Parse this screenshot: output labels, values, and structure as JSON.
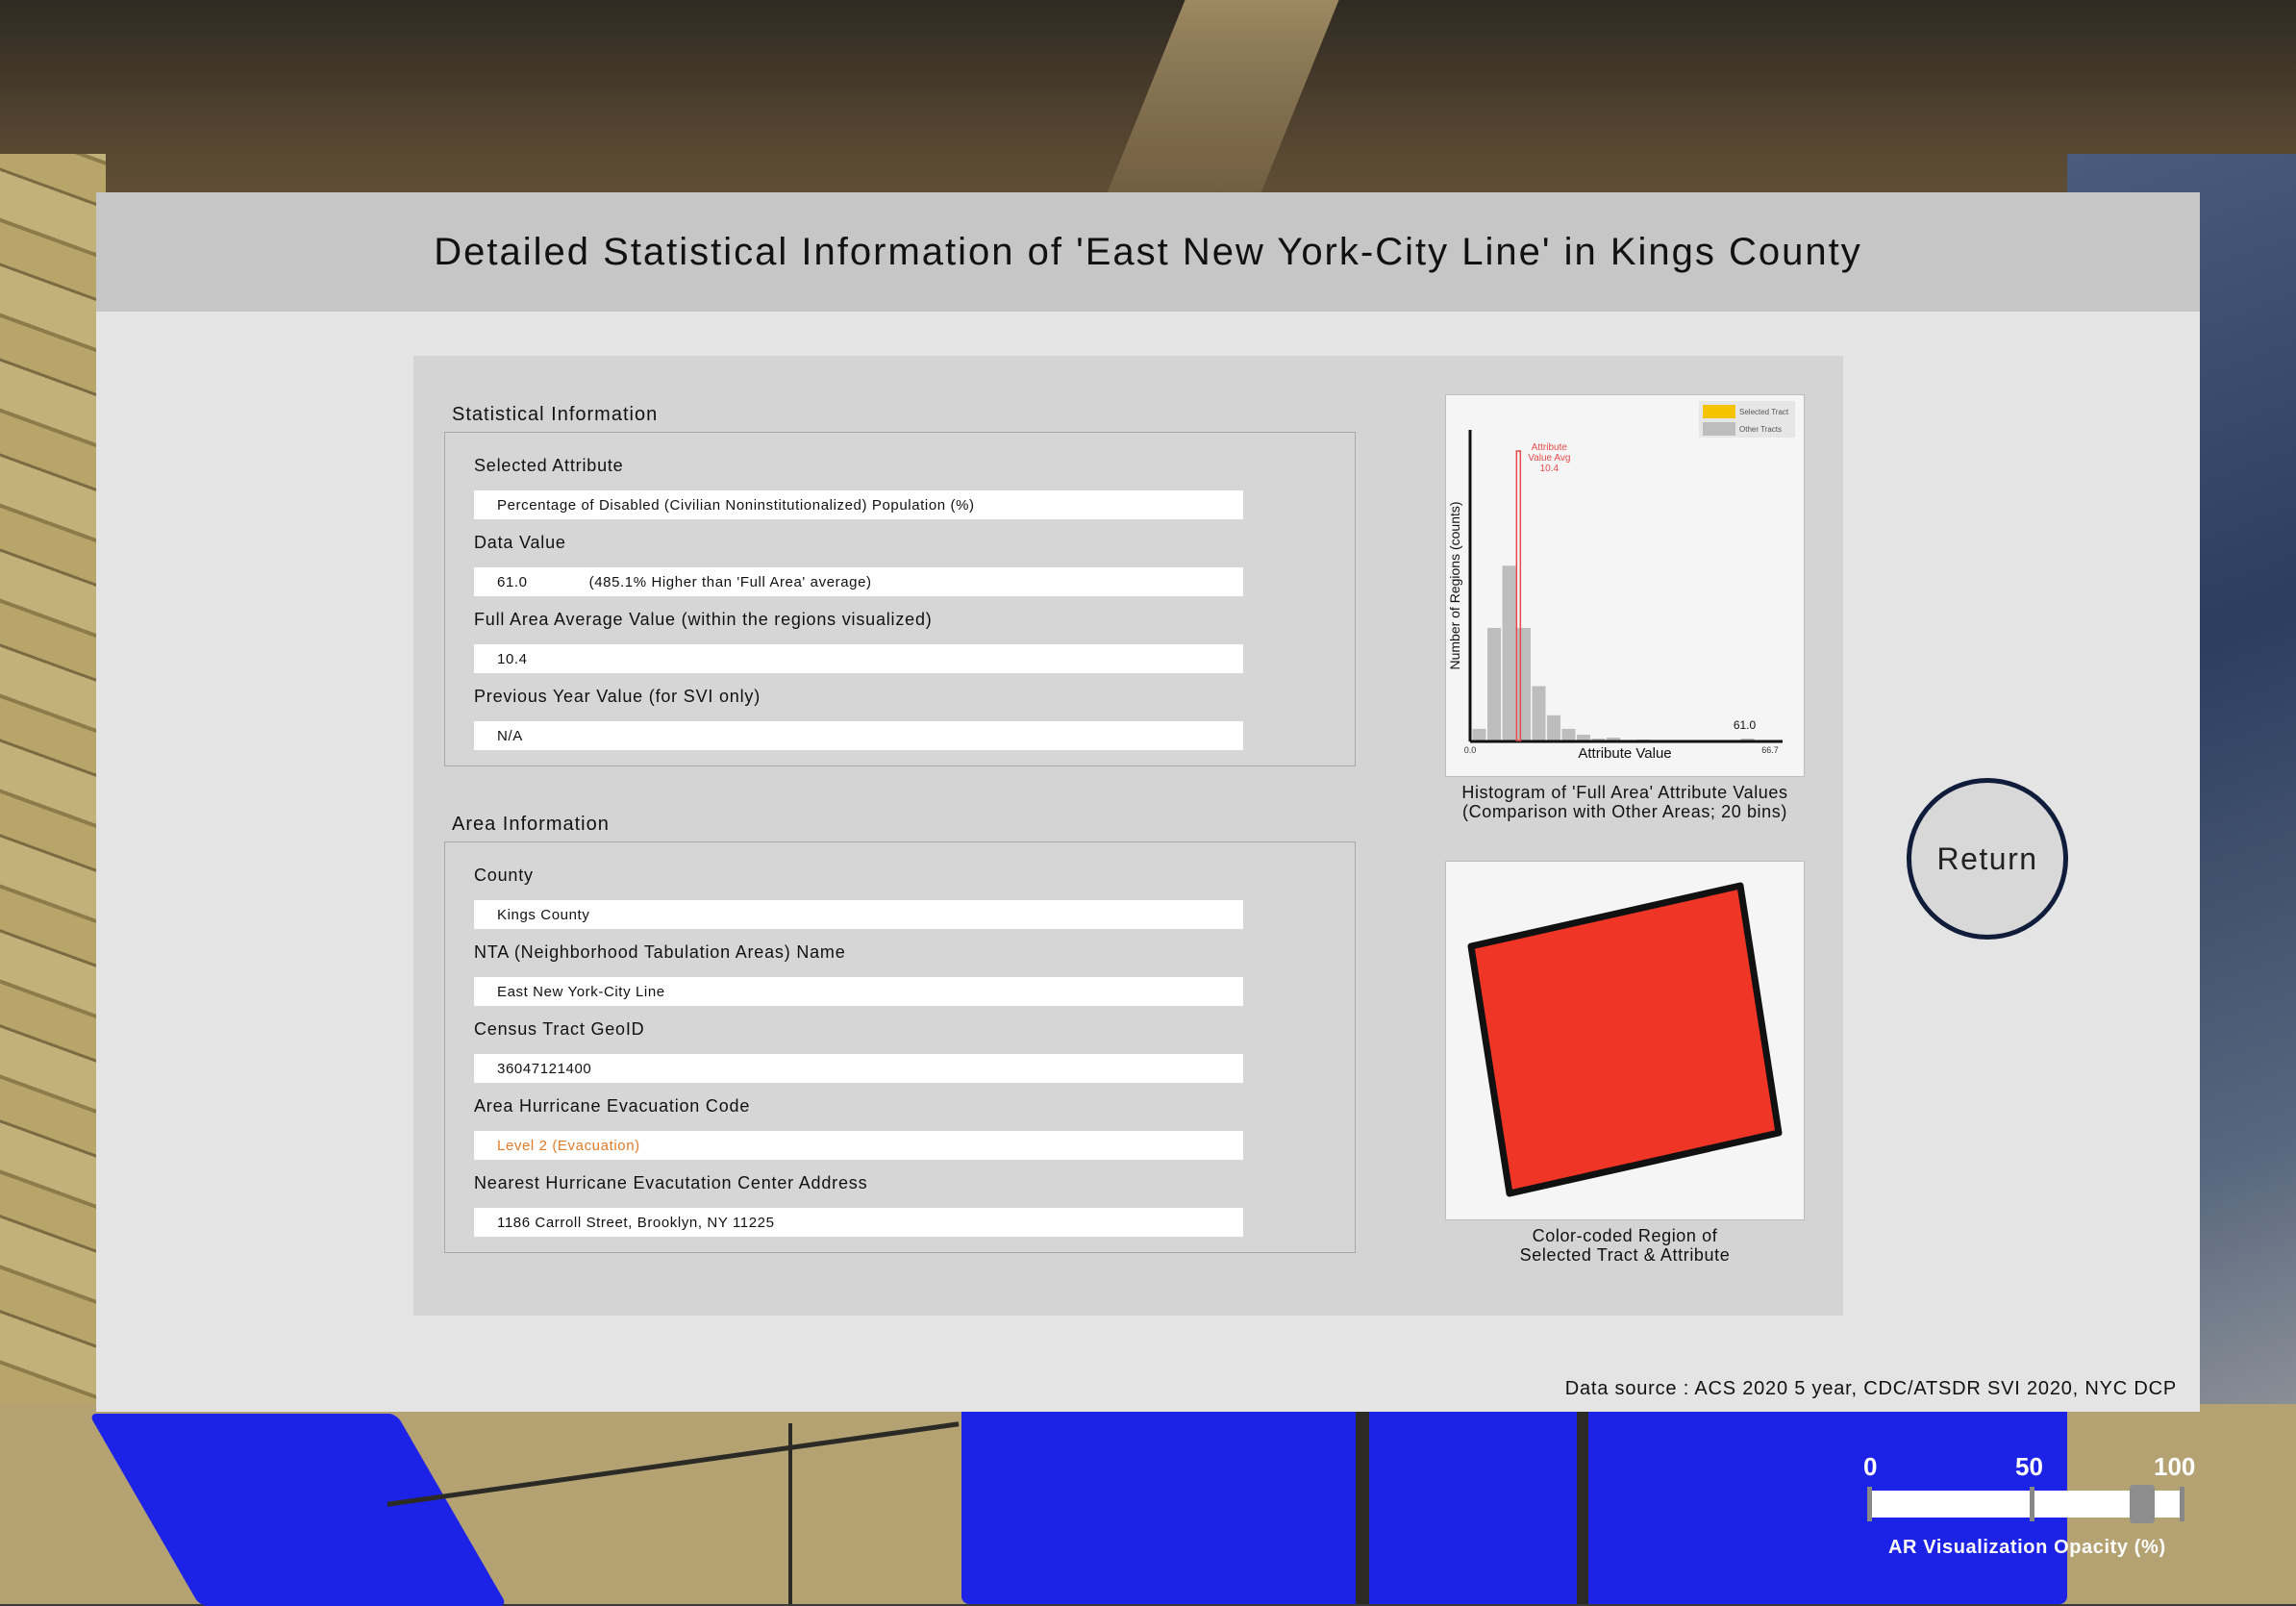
{
  "title": "Detailed Statistical Information of 'East New York-City Line' in Kings County",
  "statistical_section": {
    "label": "Statistical Information",
    "fields": [
      {
        "label": "Selected Attribute",
        "value": "Percentage of Disabled (Civilian Noninstitutionalized) Population (%)"
      },
      {
        "label": "Data Value",
        "value": "61.0",
        "extra": "(485.1% Higher than 'Full Area' average)"
      },
      {
        "label": "Full Area Average Value (within the regions visualized)",
        "value": "10.4"
      },
      {
        "label": "Previous Year Value (for SVI only)",
        "value": "N/A"
      }
    ]
  },
  "area_section": {
    "label": "Area Information",
    "fields": [
      {
        "label": "County",
        "value": "Kings County"
      },
      {
        "label": "NTA (Neighborhood Tabulation Areas) Name",
        "value": "East New York-City Line"
      },
      {
        "label": "Census Tract GeoID",
        "value": "36047121400"
      },
      {
        "label": "Area Hurricane Evacuation Code",
        "value": "Level 2 (Evacuation)"
      },
      {
        "label": "Nearest Hurricane Evacutation Center Address",
        "value": "1186 Carroll Street, Brooklyn, NY 11225"
      }
    ]
  },
  "chart_data": {
    "type": "bar",
    "title": "",
    "xlabel": "Attribute Value",
    "ylabel": "Number of Regions (counts)",
    "x_range": [
      0.0,
      66.7
    ],
    "x_min_label": "0.0",
    "x_max_label": "66.7",
    "bins": 20,
    "values": [
      6,
      58,
      90,
      58,
      28,
      13,
      6,
      3,
      1,
      1.5,
      0,
      0.5,
      0,
      0,
      0,
      0,
      0,
      0,
      1,
      0
    ],
    "ylim": [
      0,
      160
    ],
    "selected_value": 61.0,
    "selected_label": "61.0",
    "average_value": 10.4,
    "average_label_lines": [
      "Attribute",
      "Value Avg",
      "10.4"
    ],
    "legend": [
      {
        "label": "Selected Tract",
        "color": "#f5c400"
      },
      {
        "label": "Other Tracts",
        "color": "#bdbdbd"
      }
    ],
    "legend_position": "top-right",
    "bar_color": "#bdbdbd",
    "average_line_color": "#e34b4b",
    "grid": false
  },
  "histogram_caption_lines": [
    "Histogram of 'Full Area' Attribute Values",
    "(Comparison with Other Areas; 20 bins)"
  ],
  "region_caption_lines": [
    "Color-coded Region of",
    "Selected Tract & Attribute"
  ],
  "region_color": "#ef3526",
  "return_label": "Return",
  "data_source": "Data source : ACS 2020 5 year, CDC/ATSDR SVI 2020, NYC DCP",
  "opacity_slider": {
    "ticks": [
      "0",
      "50",
      "100"
    ],
    "value": 88,
    "label": "AR Visualization Opacity (%)"
  }
}
